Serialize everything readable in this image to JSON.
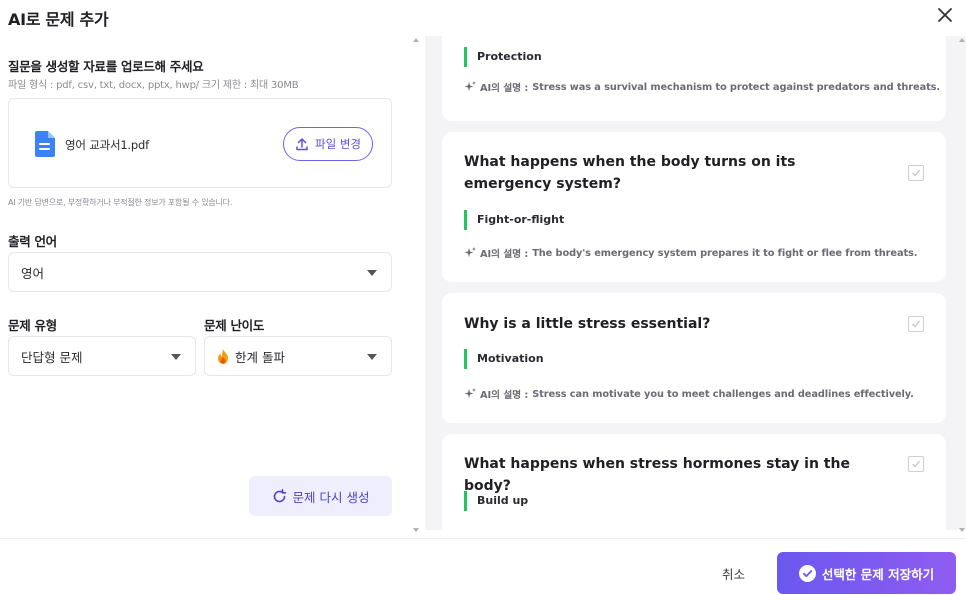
{
  "dialog": {
    "title": "AI로 문제 추가",
    "close_icon": "close-icon"
  },
  "upload": {
    "title": "질문을 생성할 자료를 업로드해 주세요",
    "subtitle": "파일 형식 : pdf, csv, txt, docx, pptx, hwp/ 크기 제한 : 최대 30MB",
    "file_name": "영어 교과서1.pdf",
    "change_label": "파일 변경",
    "ai_note": "AI 기반 답변으로, 부정확하거나 부적절한 정보가 포함될 수 있습니다."
  },
  "output_language": {
    "label": "출력 언어",
    "value": "영어"
  },
  "question_type": {
    "label": "문제 유형",
    "value": "단답형 문제"
  },
  "difficulty": {
    "label": "문제 난이도",
    "value": "한계 돌파",
    "icon": "fire-icon"
  },
  "regenerate_label": "문제 다시 생성",
  "questions": [
    {
      "question": "",
      "answer": "Protection",
      "explanation_prefix": "AI의 설명 :",
      "explanation": "Stress was a survival mechanism to protect against predators and threats."
    },
    {
      "question": "What happens when the body turns on its emergency system?",
      "answer": "Fight-or-flight",
      "explanation_prefix": "AI의 설명 :",
      "explanation": "The body's emergency system prepares it to fight or flee from threats."
    },
    {
      "question": "Why is a little stress essential?",
      "answer": "Motivation",
      "explanation_prefix": "AI의 설명 :",
      "explanation": "Stress can motivate you to meet challenges and deadlines effectively."
    },
    {
      "question": "What happens when stress hormones stay in the body?",
      "answer": "Build up",
      "explanation_prefix": "",
      "explanation": ""
    }
  ],
  "footer": {
    "cancel_label": "취소",
    "save_label": "선택한 문제 저장하기"
  },
  "colors": {
    "accent": "#6b58f0",
    "answer_bar": "#22c55e",
    "panel_bg": "#f4f4f6"
  }
}
